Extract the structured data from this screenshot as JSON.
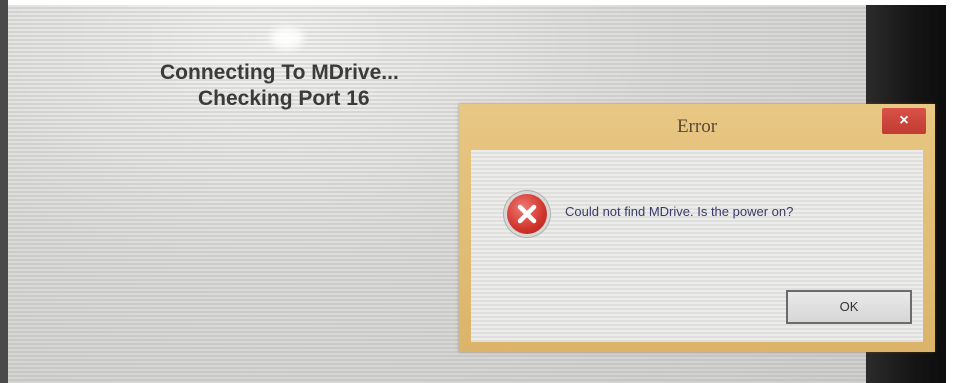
{
  "status": {
    "line1": "Connecting To MDrive...",
    "line2": "Checking Port 16"
  },
  "dialog": {
    "title": "Error",
    "close_label": "×",
    "message": "Could not find MDrive. Is the power on?",
    "ok_label": "OK",
    "icon": "error-x-icon"
  },
  "colors": {
    "dialog_frame": "#dbb46a",
    "close_button": "#c23a32",
    "error_icon": "#d0342c"
  }
}
